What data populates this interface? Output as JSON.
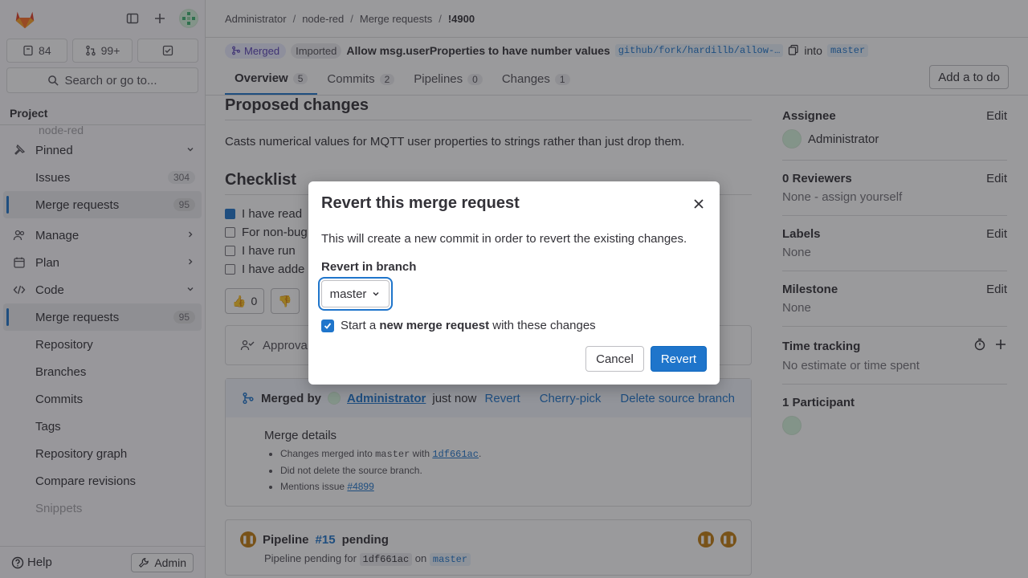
{
  "sidebar": {
    "counters": [
      {
        "icon": "issues-icon",
        "value": "84"
      },
      {
        "icon": "merge-request-icon",
        "value": "99+"
      },
      {
        "icon": "todo-icon",
        "value": ""
      }
    ],
    "search_label": "Search or go to...",
    "section_title": "Project",
    "project_name": "node-red",
    "pinned": {
      "label": "Pinned",
      "items": [
        {
          "label": "Issues",
          "count": "304"
        },
        {
          "label": "Merge requests",
          "count": "95"
        }
      ]
    },
    "groups": [
      {
        "label": "Manage",
        "icon": "users-icon"
      },
      {
        "label": "Plan",
        "icon": "calendar-icon"
      },
      {
        "label": "Code",
        "icon": "code-icon"
      }
    ],
    "code_items": [
      {
        "label": "Merge requests",
        "count": "95"
      },
      {
        "label": "Repository"
      },
      {
        "label": "Branches"
      },
      {
        "label": "Commits"
      },
      {
        "label": "Tags"
      },
      {
        "label": "Repository graph"
      },
      {
        "label": "Compare revisions"
      },
      {
        "label": "Snippets"
      }
    ],
    "help_label": "Help",
    "admin_label": "Admin"
  },
  "breadcrumb": [
    "Administrator",
    "node-red",
    "Merge requests",
    "!4900"
  ],
  "mr": {
    "status": "Merged",
    "imported": "Imported",
    "title": "Allow msg.userProperties to have number values",
    "source_branch": "github/fork/hardillb/allow-…",
    "into": "into",
    "target_branch": "master"
  },
  "tabs": [
    {
      "label": "Overview",
      "count": "5"
    },
    {
      "label": "Commits",
      "count": "2"
    },
    {
      "label": "Pipelines",
      "count": "0"
    },
    {
      "label": "Changes",
      "count": "1"
    }
  ],
  "add_todo": "Add a to do",
  "content": {
    "proposed_title": "Proposed changes",
    "description": "Casts numerical values for MQTT user properties to strings rather than just drop them.",
    "checklist_title": "Checklist",
    "checklist": [
      {
        "text": "I have read",
        "checked": true
      },
      {
        "text": "For non-bug",
        "checked": false
      },
      {
        "text": "I have run",
        "checked": false
      },
      {
        "text": "I have adde",
        "checked": false
      }
    ],
    "thumbs_up": "0",
    "approval_label": "Approva",
    "merged_by": "Merged by",
    "merged_user": "Administrator",
    "merged_when": "just now",
    "merged_actions": [
      "Revert",
      "Cherry-pick",
      "Delete source branch"
    ],
    "merge_details_title": "Merge details",
    "merge_details": {
      "line1_pre": "Changes merged into",
      "line1_branch": "master",
      "line1_mid": "with",
      "line1_commit": "1df661ac",
      "line2": "Did not delete the source branch.",
      "line3_pre": "Mentions issue",
      "line3_issue": "#4899"
    },
    "pipeline": {
      "label": "Pipeline",
      "id": "#15",
      "status": "pending",
      "sub_pre": "Pipeline pending for",
      "sub_commit": "1df661ac",
      "sub_on": "on",
      "sub_branch": "master"
    }
  },
  "right_panel": {
    "assignee": {
      "title": "Assignee",
      "edit": "Edit",
      "value": "Administrator"
    },
    "reviewers": {
      "title": "0 Reviewers",
      "edit": "Edit",
      "value": "None - assign yourself"
    },
    "labels": {
      "title": "Labels",
      "edit": "Edit",
      "value": "None"
    },
    "milestone": {
      "title": "Milestone",
      "edit": "Edit",
      "value": "None"
    },
    "time_tracking": {
      "title": "Time tracking",
      "value": "No estimate or time spent"
    },
    "participants": {
      "title": "1 Participant"
    }
  },
  "modal": {
    "title": "Revert this merge request",
    "description": "This will create a new commit in order to revert the existing changes.",
    "branch_label": "Revert in branch",
    "branch_value": "master",
    "check_pre": "Start a",
    "check_bold": "new merge request",
    "check_post": "with these changes",
    "cancel": "Cancel",
    "submit": "Revert"
  },
  "colors": {
    "accent": "#1f75cb",
    "merged": "#5943b6",
    "pending": "#c17d10"
  }
}
